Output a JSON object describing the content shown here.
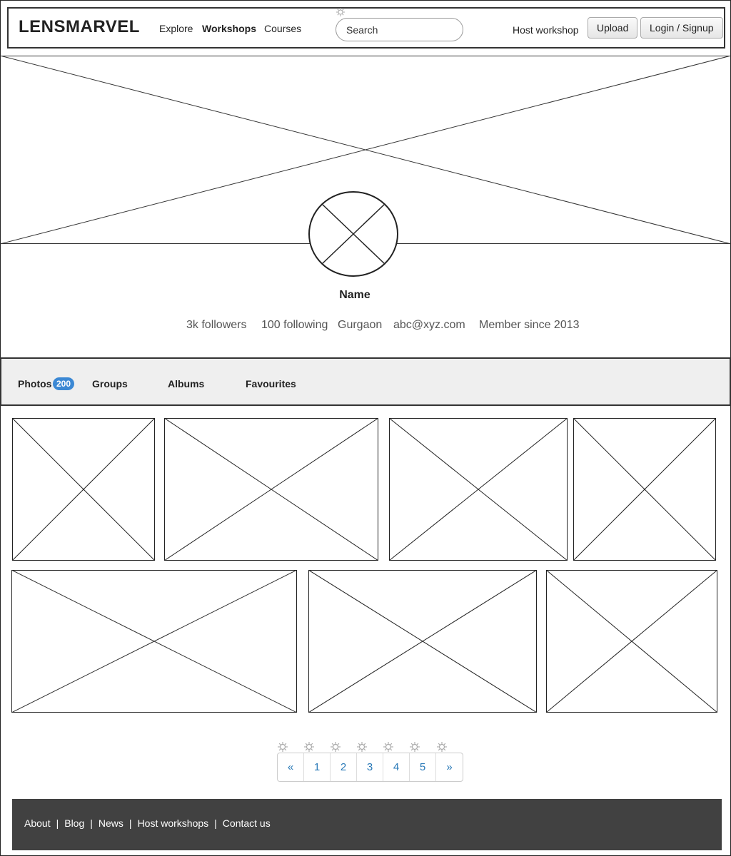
{
  "header": {
    "logo": "LENSMARVEL",
    "nav": [
      "Explore",
      "Workshops",
      "Courses"
    ],
    "search_placeholder": "Search",
    "host_link": "Host workshop",
    "upload_label": "Upload",
    "login_label": "Login / Signup"
  },
  "profile": {
    "name": "Name",
    "followers": "3k followers",
    "following": "100 following",
    "location": "Gurgaon",
    "email": "abc@xyz.com",
    "member_since": "Member since 2013"
  },
  "tabs": {
    "photos": "Photos",
    "photos_count": "200",
    "groups": "Groups",
    "albums": "Albums",
    "favourites": "Favourites"
  },
  "pagination": {
    "prev": "«",
    "pages": [
      "1",
      "2",
      "3",
      "4",
      "5"
    ],
    "next": "»"
  },
  "footer": {
    "links": [
      "About",
      "Blog",
      "News",
      "Host workshops",
      "Contact us"
    ],
    "separator": "|"
  },
  "icons": {
    "placeholder": "image-placeholder-icon",
    "gear": "gear-icon"
  }
}
